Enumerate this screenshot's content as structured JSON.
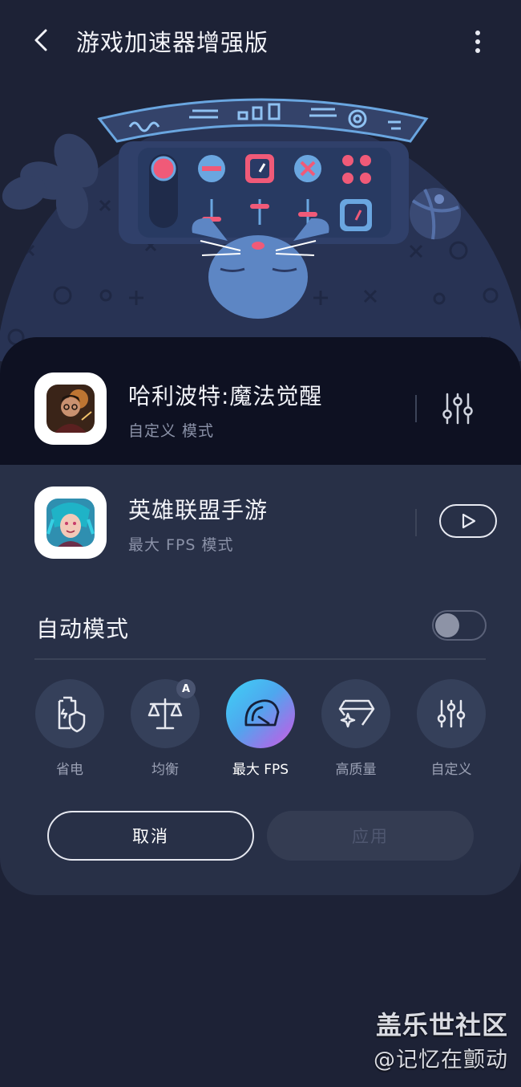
{
  "header": {
    "title": "游戏加速器增强版",
    "back_icon": "back-arrow-icon",
    "more_icon": "more-vertical-icon"
  },
  "games": [
    {
      "name": "哈利波特:魔法觉醒",
      "mode": "自定义 模式",
      "action_icon": "sliders-icon",
      "selected": true
    },
    {
      "name": "英雄联盟手游",
      "mode": "最大 FPS 模式",
      "action_icon": "play-icon",
      "selected": false
    }
  ],
  "auto_mode": {
    "label": "自动模式",
    "enabled": false
  },
  "modes": [
    {
      "label": "省电",
      "icon": "battery-shield-icon",
      "active": false
    },
    {
      "label": "均衡",
      "icon": "balance-scale-icon",
      "active": false,
      "badge": "A"
    },
    {
      "label": "最大 FPS",
      "icon": "speedometer-icon",
      "active": true
    },
    {
      "label": "高质量",
      "icon": "diamond-sparkle-icon",
      "active": false
    },
    {
      "label": "自定义",
      "icon": "sliders-icon",
      "active": false
    }
  ],
  "buttons": {
    "cancel": "取消",
    "apply": "应用"
  },
  "watermark": {
    "line1": "盖乐世社区",
    "line2": "@记忆在颤动"
  },
  "colors": {
    "background": "#1d2236",
    "panel": "#283047",
    "selected_row": "#0e1122",
    "accent_pink": "#f05a78",
    "accent_blue": "#6aa6e0"
  }
}
